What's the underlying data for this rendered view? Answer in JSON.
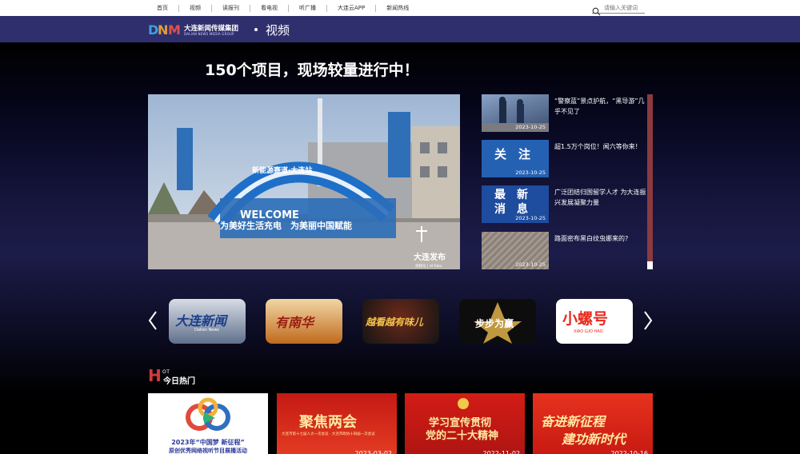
{
  "nav": {
    "links": [
      "首页",
      "视频",
      "读报刊",
      "看电视",
      "听广播",
      "大连云APP",
      "新闻热线"
    ],
    "search_placeholder": "请输入关键词"
  },
  "brand": {
    "name": "大连新闻传媒集团",
    "subtitle": "DALIAN NEWS MEDIA GROUP",
    "section": "视频"
  },
  "hero": {
    "title": "150个项目，现场较量进行中！",
    "overlay_top": "新能源赛道·大连站",
    "overlay_welcome": "WELCOME",
    "overlay_bottom": "为美好生活充电　为美丽中国赋能",
    "overlay_watermark": "大连发布",
    "overlay_watermark_sub": "视频号 | dl-fabu"
  },
  "side_list": [
    {
      "text": "“警察蓝”景点护航，“黑导游”几乎不见了",
      "date": "2023-10-25",
      "thumb_label": ""
    },
    {
      "text": "超1.5万个岗位！闻六等你来！",
      "date": "2023-10-25",
      "thumb_label": "关　注"
    },
    {
      "text": "广泛团结归国留学人才 为大连振兴发展凝聚力量",
      "date": "2023-10-25",
      "thumb_label_1": "最　新",
      "thumb_label_2": "消　息"
    },
    {
      "text": "路面密布黑白纹虫娜来的?",
      "date": "2023-10-25",
      "thumb_label": ""
    }
  ],
  "carousel": [
    {
      "label": "大连新闻",
      "sub": "Dalian News"
    },
    {
      "label": "有南华",
      "sub": ""
    },
    {
      "label": "越看越有味儿",
      "sub": ""
    },
    {
      "label": "步步为赢",
      "sub": ""
    },
    {
      "label": "小螺号",
      "sub": "XIAO LUO HAO"
    }
  ],
  "hot": {
    "letter": "H",
    "letters_small": "OT",
    "title": "今日热门",
    "cards": [
      {
        "title": "2023年“中国梦 新征程”",
        "sub": "原创优秀网络视听节目展播活动",
        "date": ""
      },
      {
        "title": "聚焦两会",
        "sub": "大连市第十七届人大一次会议 · 大连市政协十四届一次会议",
        "date": "2023-03-02"
      },
      {
        "title": "学习宣传贯彻",
        "sub": "党的二十大精神",
        "date": "2022-11-02"
      },
      {
        "title": "奋进新征程",
        "sub": "建功新时代",
        "date": "2022-10-16"
      }
    ]
  },
  "colors": {
    "brandbar": "#2f2f6e",
    "accent_red": "#d43a3a",
    "scrollbar": "#8b3a3f"
  }
}
